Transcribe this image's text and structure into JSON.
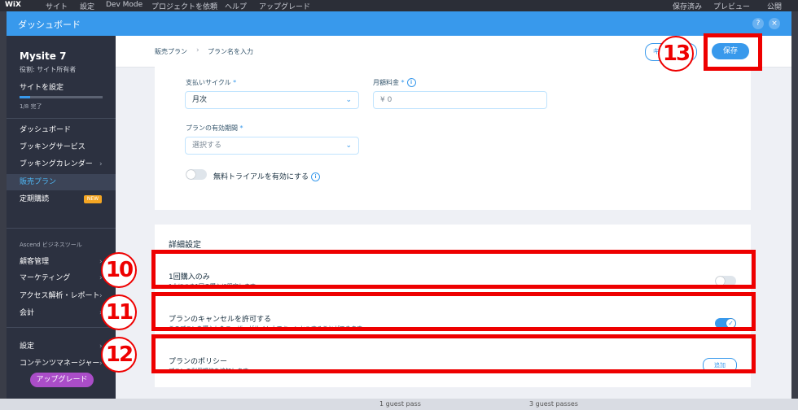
{
  "topbar": {
    "logo": "WiX",
    "items": [
      "サイト",
      "設定",
      "Dev Mode",
      "プロジェクトを依頼",
      "ヘルプ",
      "アップグレード"
    ],
    "right": [
      "保存済み",
      "プレビュー",
      "公開"
    ]
  },
  "modal": {
    "title": "ダッシュボード",
    "help_icon": "?",
    "close_icon": "×"
  },
  "sidebar": {
    "site_name": "Mysite 7",
    "role": "役割: サイト所有者",
    "setup_label": "サイトを設定",
    "progress_text": "1/8 完了",
    "progress_fraction": 0.125,
    "items": [
      {
        "label": "ダッシュボード"
      },
      {
        "label": "ブッキングサービス"
      },
      {
        "label": "ブッキングカレンダー",
        "chevron": "›"
      },
      {
        "label": "販売プラン"
      },
      {
        "label": "定期購読",
        "badge": "NEW"
      }
    ],
    "section_title": "Ascend ビジネスツール",
    "items2": [
      {
        "label": "顧客管理",
        "chevron": "›"
      },
      {
        "label": "マーケティング",
        "chevron": "›"
      },
      {
        "label": "アクセス解析・レポート",
        "chevron": "›"
      },
      {
        "label": "会計",
        "chevron": "›"
      }
    ],
    "items3": [
      {
        "label": "設定",
        "chevron": "›"
      },
      {
        "label": "コンテンツマネージャー",
        "chevron": "›"
      }
    ],
    "upgrade_label": "アップグレード"
  },
  "header": {
    "crumb1": "販売プラン",
    "crumb_sep": "›",
    "crumb2": "プラン名を入力",
    "cancel_label": "キャンセル",
    "save_label": "保存"
  },
  "form": {
    "cycle_label": "支払いサイクル",
    "cycle_value": "月次",
    "fee_label": "月額料金",
    "fee_value": "¥ 0",
    "duration_label": "プランの有効期間",
    "duration_placeholder": "選択する",
    "trial_label": "無料トライアルを有効にする",
    "required_mark": "*",
    "info_mark": "i",
    "chevron": "⌄"
  },
  "advanced": {
    "title": "詳細設定",
    "once_title": "1回購入のみ",
    "once_desc": "1人につき1回の購入に限定します。",
    "cancel_title": "プランのキャンセルを許可する",
    "cancel_desc": "このプランを購入したユーザーがサイト上でキャンセルすることができます。",
    "policy_title": "プランのポリシー",
    "policy_desc": "プランの利用規約を追加します。",
    "add_label": "追加",
    "check": "✓"
  },
  "annotations": {
    "n10": "10",
    "n11": "11",
    "n12": "12",
    "n13": "13",
    "color": "#ee0000"
  },
  "bottom": {
    "left": "1 guest pass",
    "right": "3 guest passes"
  }
}
